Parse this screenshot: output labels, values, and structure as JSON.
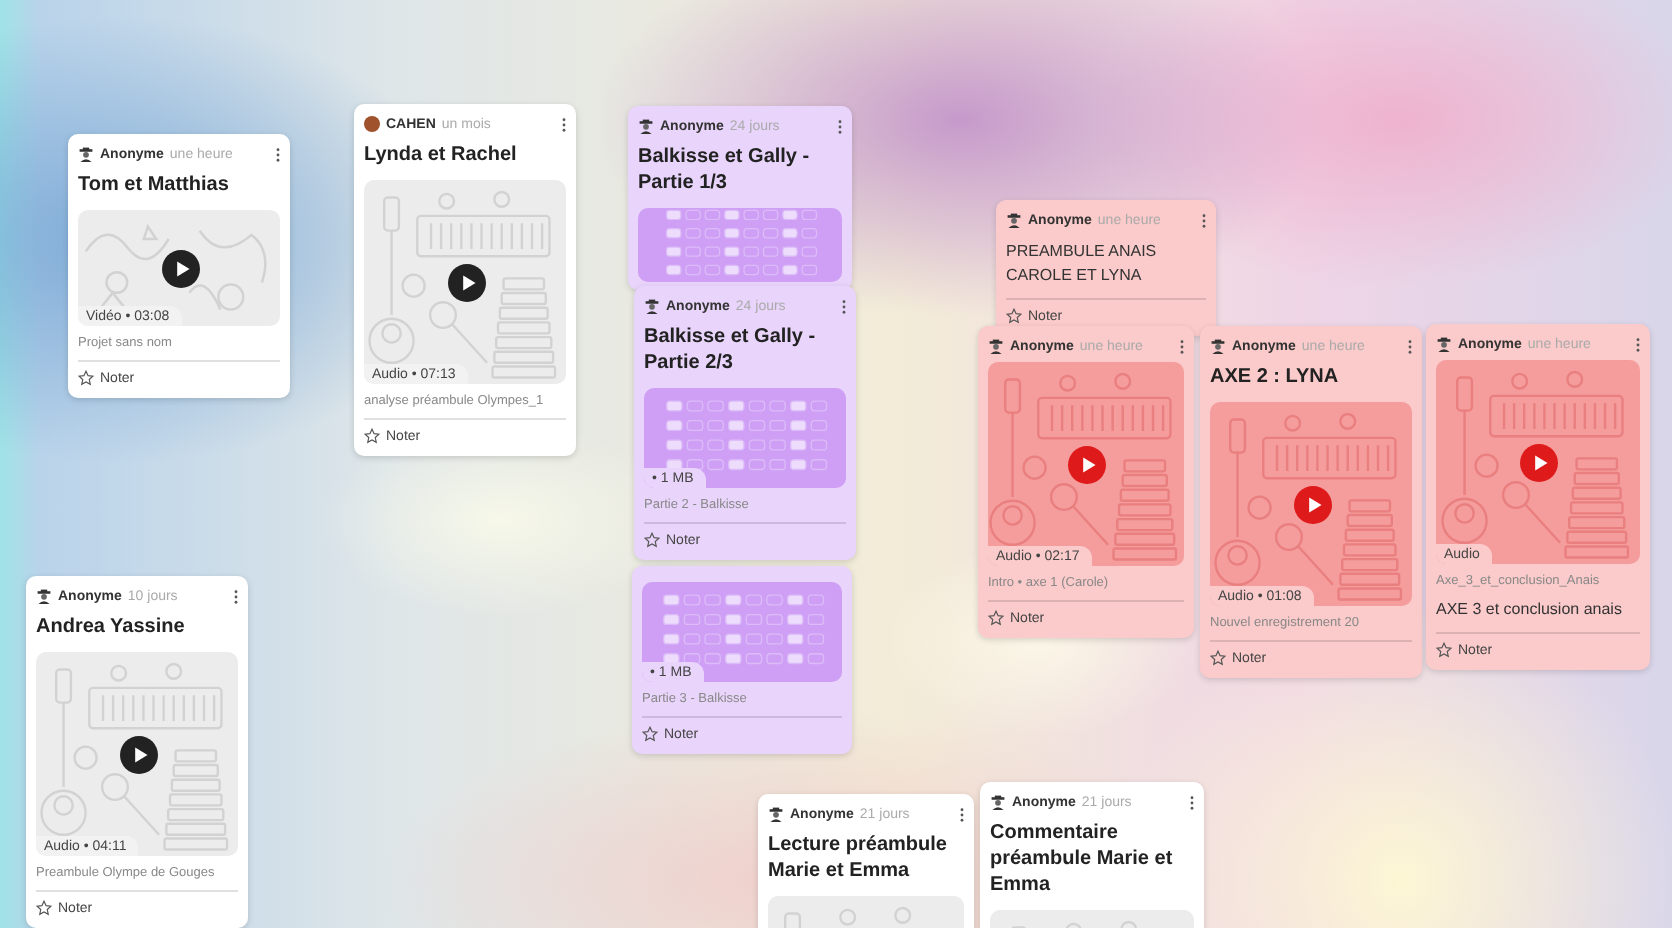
{
  "cards": [
    {
      "color": "#ffffff",
      "author": "Anonyme",
      "avatar": {
        "kind": "anonymous"
      },
      "time": "une heure",
      "title": "Tom et Matthias",
      "media": {
        "kind": "video",
        "label": "Vidéo • 03:08"
      },
      "caption": "Projet sans nom",
      "rate_label": "Noter"
    },
    {
      "color": "#ffffff",
      "author": "CAHEN",
      "avatar": {
        "kind": "photo"
      },
      "time": "un mois",
      "title": "Lynda et Rachel",
      "media": {
        "kind": "audio",
        "label": "Audio • 07:13"
      },
      "caption": "analyse préambule Olympes_1",
      "rate_label": "Noter"
    },
    {
      "color": "#e9d4fb",
      "author": "Anonyme",
      "avatar": {
        "kind": "anonymous"
      },
      "time": "24 jours",
      "title": "Balkisse et Gally - Partie 1/3",
      "media": {
        "kind": "file"
      }
    },
    {
      "color": "#e9d4fb",
      "author": "Anonyme",
      "avatar": {
        "kind": "anonymous"
      },
      "time": "24 jours",
      "title": "Balkisse et Gally - Partie 2/3",
      "media": {
        "kind": "file",
        "label": "• 1 MB"
      },
      "caption": "Partie 2 - Balkisse",
      "rate_label": "Noter"
    },
    {
      "color": "#e9d4fb",
      "media": {
        "kind": "file",
        "label": "• 1 MB"
      },
      "caption": "Partie 3 - Balkisse",
      "rate_label": "Noter"
    },
    {
      "color": "#fbcaca",
      "author": "Anonyme",
      "avatar": {
        "kind": "anonymous"
      },
      "time": "une heure",
      "body": "PREAMBULE ANAIS CAROLE ET LYNA",
      "rate_label": "Noter"
    },
    {
      "color": "#fbcaca",
      "author": "Anonyme",
      "avatar": {
        "kind": "anonymous"
      },
      "time": "une heure",
      "media": {
        "kind": "audio",
        "label": "Audio • 02:17"
      },
      "caption": "Intro • axe 1 (Carole)",
      "rate_label": "Noter"
    },
    {
      "color": "#fbcaca",
      "author": "Anonyme",
      "avatar": {
        "kind": "anonymous"
      },
      "time": "une heure",
      "title": "AXE 2 : LYNA",
      "media": {
        "kind": "audio",
        "label": "Audio • 01:08"
      },
      "caption": "Nouvel enregistrement 20",
      "rate_label": "Noter"
    },
    {
      "color": "#fbcaca",
      "author": "Anonyme",
      "avatar": {
        "kind": "anonymous"
      },
      "time": "une heure",
      "media": {
        "kind": "audio",
        "label": "Audio"
      },
      "caption": "Axe_3_et_conclusion_Anais",
      "body": "AXE 3 et conclusion anais",
      "rate_label": "Noter"
    },
    {
      "color": "#ffffff",
      "author": "Anonyme",
      "avatar": {
        "kind": "anonymous"
      },
      "time": "10 jours",
      "title": "Andrea Yassine",
      "media": {
        "kind": "audio",
        "label": "Audio • 04:11"
      },
      "caption": "Preambule Olympe de Gouges",
      "rate_label": "Noter"
    },
    {
      "color": "#ffffff",
      "author": "Anonyme",
      "avatar": {
        "kind": "anonymous"
      },
      "time": "21 jours",
      "title": "Lecture préambule Marie et Emma",
      "media": {
        "kind": "audio"
      }
    },
    {
      "color": "#ffffff",
      "author": "Anonyme",
      "avatar": {
        "kind": "anonymous"
      },
      "time": "21 jours",
      "title": "Commentaire préambule Marie et Emma",
      "media": {
        "kind": "audio"
      }
    }
  ]
}
